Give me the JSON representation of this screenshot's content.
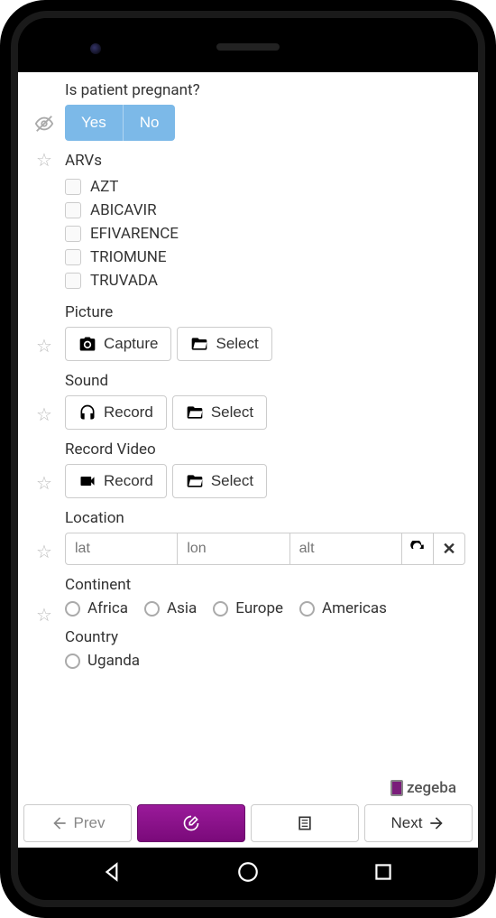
{
  "questions": {
    "pregnant": {
      "label": "Is patient pregnant?",
      "yes": "Yes",
      "no": "No"
    },
    "arvs": {
      "label": "ARVs",
      "items": [
        "AZT",
        "ABICAVIR",
        "EFIVARENCE",
        "TRIOMUNE",
        "TRUVADA"
      ]
    },
    "picture": {
      "label": "Picture",
      "capture": "Capture",
      "select": "Select"
    },
    "sound": {
      "label": "Sound",
      "record": "Record",
      "select": "Select"
    },
    "video": {
      "label": "Record Video",
      "record": "Record",
      "select": "Select"
    },
    "location": {
      "label": "Location",
      "lat_ph": "lat",
      "lon_ph": "lon",
      "alt_ph": "alt"
    },
    "continent": {
      "label": "Continent",
      "options": [
        "Africa",
        "Asia",
        "Europe",
        "Americas"
      ]
    },
    "country": {
      "label": "Country",
      "options": [
        "Uganda"
      ]
    }
  },
  "brand": "zegeba",
  "nav": {
    "prev": "Prev",
    "next": "Next"
  },
  "colors": {
    "accent": "#8e0d8e",
    "toggle": "#7cb9e8"
  }
}
